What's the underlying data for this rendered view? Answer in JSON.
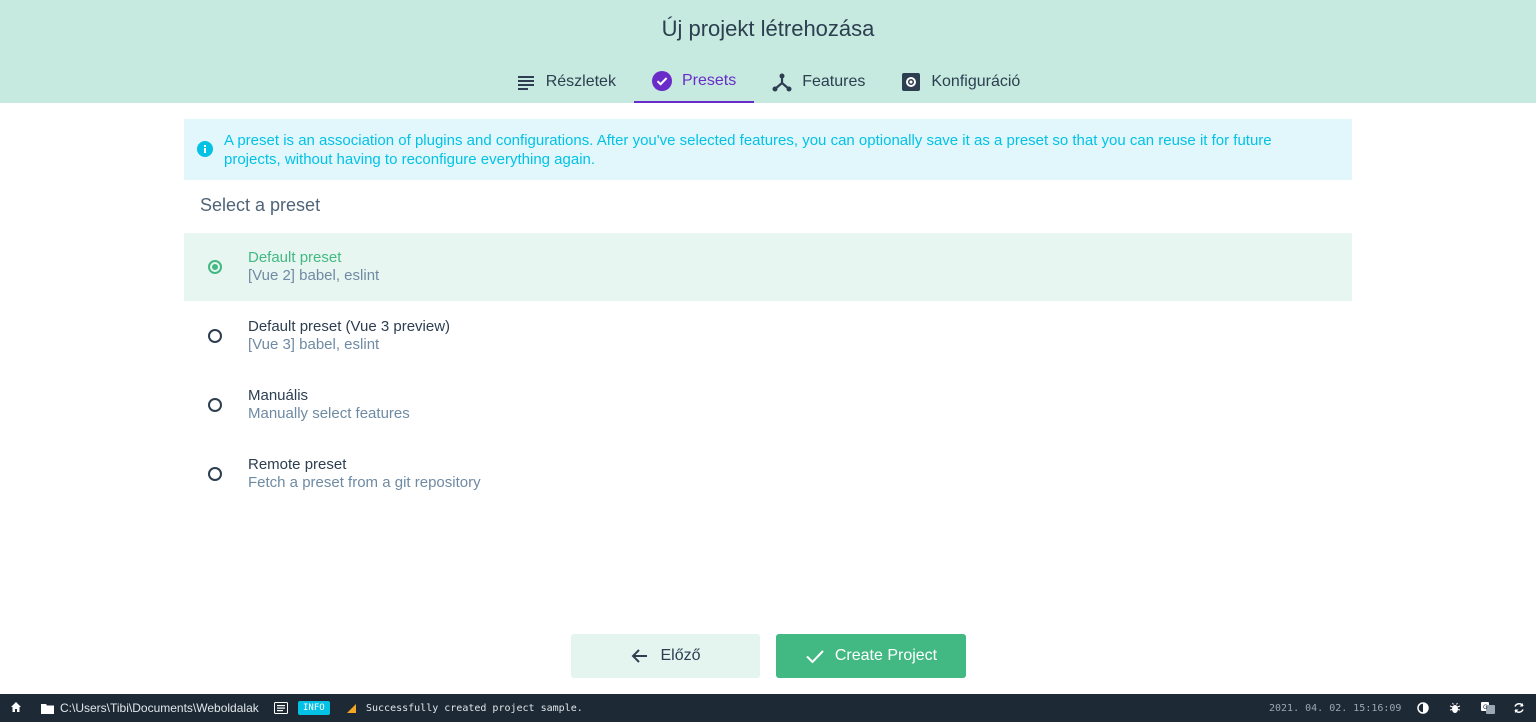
{
  "header": {
    "title": "Új projekt létrehozása",
    "tabs": [
      {
        "label": "Részletek",
        "icon": "subject-icon"
      },
      {
        "label": "Presets",
        "icon": "check-circle-icon",
        "active": true
      },
      {
        "label": "Features",
        "icon": "call-split-icon"
      },
      {
        "label": "Konfiguráció",
        "icon": "settings-box-icon"
      }
    ]
  },
  "info": {
    "text": "A preset is an association of plugins and configurations. After you've selected features, you can optionally save it as a preset so that you can reuse it for future projects, without having to reconfigure everything again."
  },
  "presets": {
    "section_title": "Select a preset",
    "items": [
      {
        "name": "Default preset",
        "description": "[Vue 2] babel, eslint",
        "selected": true
      },
      {
        "name": "Default preset (Vue 3 preview)",
        "description": "[Vue 3] babel, eslint",
        "selected": false
      },
      {
        "name": "Manuális",
        "description": "Manually select features",
        "selected": false
      },
      {
        "name": "Remote preset",
        "description": "Fetch a preset from a git repository",
        "selected": false
      }
    ]
  },
  "actions": {
    "prev_label": "Előző",
    "create_label": "Create Project"
  },
  "statusbar": {
    "path": "C:\\Users\\Tibi\\Documents\\Weboldalak",
    "log_level": "INFO",
    "log_message": "Successfully created project sample.",
    "timestamp": "2021. 04. 02. 15:16:09"
  },
  "colors": {
    "header_bg": "#c6eadf",
    "accent_green": "#42b983",
    "accent_purple": "#6a2cc8",
    "info_blue": "#03c2e6",
    "statusbar_bg": "#1d2935"
  }
}
